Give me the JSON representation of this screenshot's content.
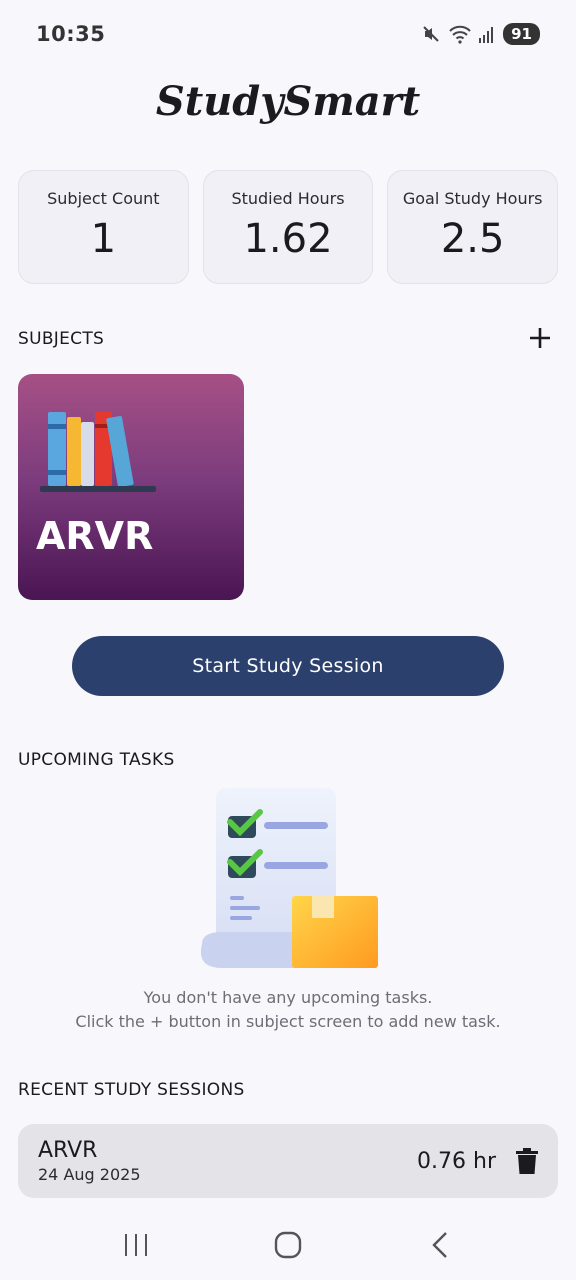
{
  "status_bar": {
    "time": "10:35",
    "battery": "91",
    "icons": [
      "mute-icon",
      "wifi-icon",
      "signal-icon"
    ]
  },
  "app": {
    "title": "StudySmart"
  },
  "stats": [
    {
      "label": "Subject Count",
      "value": "1"
    },
    {
      "label": "Studied Hours",
      "value": "1.62"
    },
    {
      "label": "Goal Study Hours",
      "value": "2.5"
    }
  ],
  "subjects_section": {
    "title": "SUBJECTS",
    "add_icon": "plus-icon",
    "items": [
      {
        "name": "ARVR",
        "colors": [
          "#a65085",
          "#4a1553"
        ],
        "icon": "books-icon"
      }
    ]
  },
  "start_button": {
    "label": "Start Study Session",
    "color": "#2c406e"
  },
  "tasks_section": {
    "title": "UPCOMING TASKS",
    "empty_line1": "You don't have any upcoming tasks.",
    "empty_line2": "Click the + button in subject screen to add new task.",
    "illustration": "checklist-icon"
  },
  "sessions_section": {
    "title": "RECENT STUDY SESSIONS",
    "items": [
      {
        "subject": "ARVR",
        "date": "24 Aug 2025",
        "duration": "0.76 hr",
        "action_icon": "trash-icon"
      }
    ]
  },
  "nav_bar": {
    "icons": [
      "recents-icon",
      "home-icon",
      "back-icon"
    ]
  }
}
